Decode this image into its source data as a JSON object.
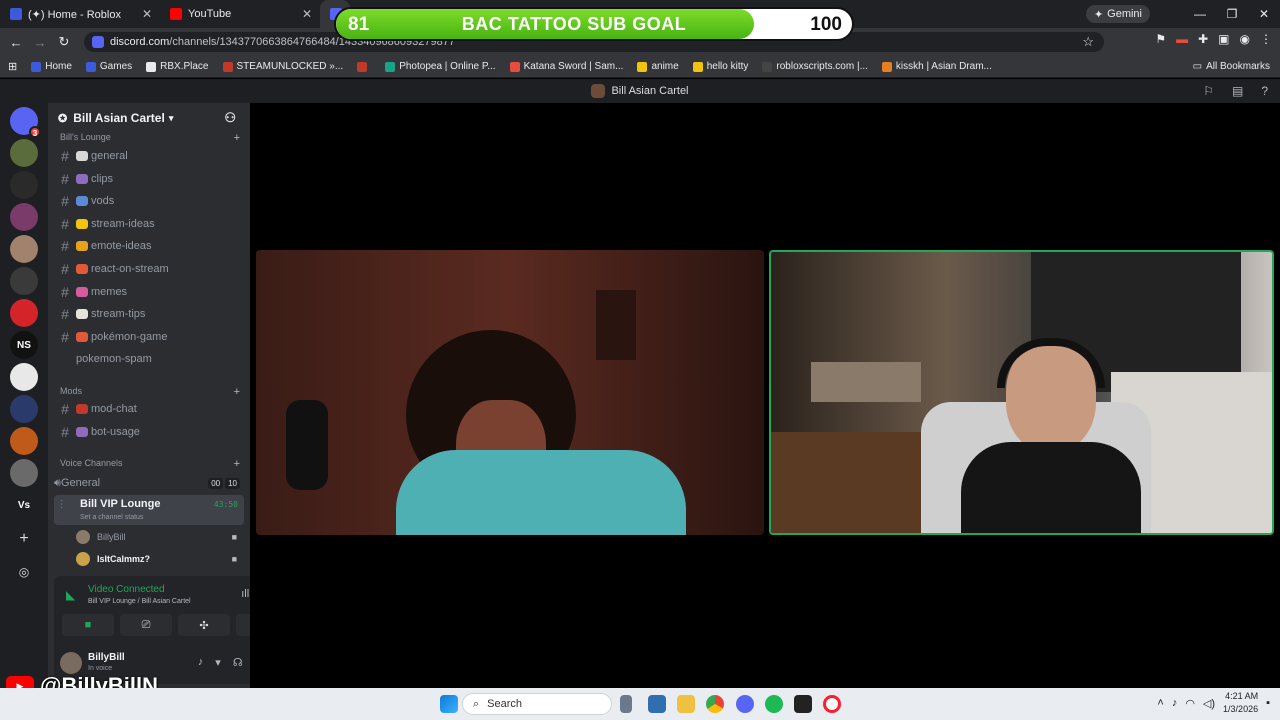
{
  "browser": {
    "tabs": [
      {
        "label": "(✦) Home - Roblox",
        "color": "#3b5bdb"
      },
      {
        "label": "YouTube",
        "color": "#ff0000"
      }
    ],
    "gemini_label": "Gemini",
    "url_host": "discord.com",
    "url_path": "/channels/1343770663864766484/1433409686093279877",
    "bookmarks": [
      {
        "label": "Home",
        "color": "#3b5bdb"
      },
      {
        "label": "Games",
        "color": "#3b5bdb"
      },
      {
        "label": "RBX.Place",
        "color": "#e8eaed"
      },
      {
        "label": "STEAMUNLOCKED »...",
        "color": "#c0392b"
      },
      {
        "label": "",
        "color": "#c0392b"
      },
      {
        "label": "Photopea | Online P...",
        "color": "#17a589"
      },
      {
        "label": "Katana Sword | Sam...",
        "color": "#e74c3c"
      },
      {
        "label": "anime",
        "color": "#f1c40f"
      },
      {
        "label": "hello kitty",
        "color": "#f1c40f"
      },
      {
        "label": "robloxscripts.com |...",
        "color": "#444"
      },
      {
        "label": "kisskh | Asian Dram...",
        "color": "#e67e22"
      }
    ],
    "all_bookmarks": "All Bookmarks"
  },
  "overlay": {
    "current": "81",
    "title": "BAC TATTOO SUB GOAL",
    "goal": "100",
    "progress": 0.81
  },
  "discord": {
    "window_title": "Bill Asian Cartel",
    "server_name": "Bill Asian Cartel",
    "categories": {
      "lounge": "Bill's Lounge",
      "mods": "Mods",
      "voice": "Voice Channels"
    },
    "text_channels": [
      {
        "label": "general",
        "emoji": "#d8d8d8"
      },
      {
        "label": "clips",
        "emoji": "#8e6bbf"
      },
      {
        "label": "vods",
        "emoji": "#5b8bd6"
      },
      {
        "label": "stream-ideas",
        "emoji": "#f1c40f"
      },
      {
        "label": "emote-ideas",
        "emoji": "#e6a21a"
      },
      {
        "label": "react-on-stream",
        "emoji": "#e05a3a"
      },
      {
        "label": "memes",
        "emoji": "#d65b9c"
      },
      {
        "label": "stream-tips",
        "emoji": "#e8e3d8"
      },
      {
        "label": "pokémon-game",
        "emoji": "#e05a3a"
      },
      {
        "label": "pokemon-spam",
        "emoji": ""
      }
    ],
    "mod_channels": [
      {
        "label": "mod-chat",
        "emoji": "#c0392b"
      },
      {
        "label": "bot-usage",
        "emoji": "#8e6bbf"
      }
    ],
    "voice_general": "General",
    "voice_general_counts": [
      "00",
      "10"
    ],
    "active_voice": {
      "name": "Bill VIP Lounge",
      "timer": "43:50",
      "status": "Set a channel status"
    },
    "voice_users": [
      {
        "name": "BillyBill",
        "bold": false
      },
      {
        "name": "IsItCalmmz?",
        "bold": true
      }
    ],
    "voice_panel": {
      "status": "Video Connected",
      "location": "Bill VIP Lounge / Bill Asian Cartel"
    },
    "user": {
      "name": "BillyBill",
      "status": "In voice"
    },
    "servers": [
      {
        "label": "",
        "color": "#5865f2",
        "badge": "3"
      },
      {
        "label": "",
        "color": "#5a6b3c"
      },
      {
        "label": "",
        "color": "#2a2a2a"
      },
      {
        "label": "",
        "color": "#7a3a6a"
      },
      {
        "label": "",
        "color": "#a0826d"
      },
      {
        "label": "",
        "color": "#3a3a3a"
      },
      {
        "label": "",
        "color": "#d4242a"
      },
      {
        "label": "NS",
        "color": "#111"
      },
      {
        "label": "",
        "color": "#e8e8e8"
      },
      {
        "label": "",
        "color": "#2a3a6a"
      },
      {
        "label": "",
        "color": "#c05a1a"
      },
      {
        "label": "",
        "color": "#6a6a6a"
      },
      {
        "label": "Vs",
        "color": "#1e1f22"
      }
    ]
  },
  "watermark": "@BillyBillN",
  "taskbar": {
    "search_placeholder": "Search",
    "time": "4:21 AM",
    "date": "1/3/2026"
  }
}
